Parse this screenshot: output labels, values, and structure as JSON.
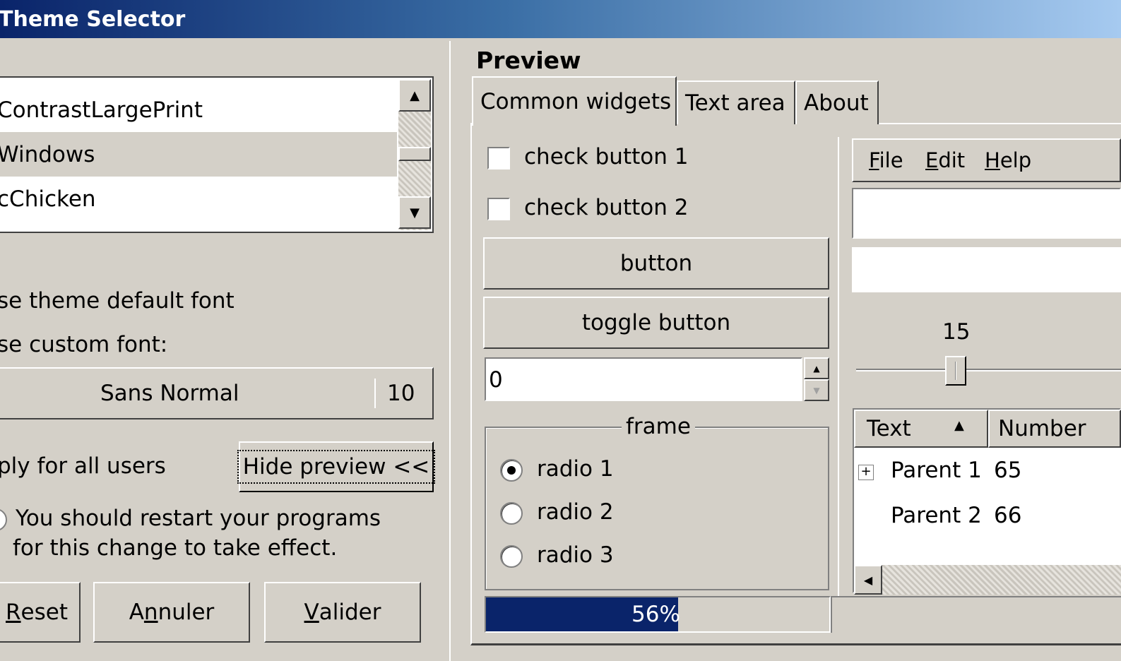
{
  "window": {
    "title": "Theme Selector"
  },
  "theme_list": {
    "items": [
      {
        "label": "ContrastLargePrint",
        "selected": false
      },
      {
        "label": "Windows",
        "selected": true
      },
      {
        "label": "cChicken",
        "selected": false
      }
    ]
  },
  "font": {
    "default_option": "se theme default font",
    "custom_option": "se custom font:",
    "name": "Sans Normal",
    "size": "10"
  },
  "apply_all_users": "ply for all users",
  "hide_preview_button": "Hide preview <<",
  "restart_note": {
    "line1": "You should restart your programs",
    "line2": "for this change to take effect."
  },
  "buttons": {
    "reset": {
      "pre": "",
      "mnemonic": "R",
      "post": "eset"
    },
    "cancel": {
      "pre": "A",
      "mnemonic": "n",
      "post": "nuler"
    },
    "ok": {
      "pre": "",
      "mnemonic": "V",
      "post": "alider"
    }
  },
  "preview": {
    "title": "Preview",
    "tabs": [
      {
        "label": "Common widgets",
        "active": true
      },
      {
        "label": "Text area",
        "active": false
      },
      {
        "label": "About",
        "active": false
      }
    ],
    "check_button_1": "check button 1",
    "check_button_2": "check button 2",
    "button": "button",
    "toggle_button": "toggle button",
    "spin_value": "0",
    "frame_label": "frame",
    "radios": [
      "radio 1",
      "radio 2",
      "radio 3"
    ],
    "radio_selected": 0,
    "progress": {
      "value": 0.56,
      "label": "56%"
    },
    "menu": {
      "file": {
        "mnemonic": "F",
        "rest": "ile"
      },
      "edit": {
        "mnemonic": "E",
        "rest": "dit"
      },
      "help": {
        "mnemonic": "H",
        "rest": "elp"
      }
    },
    "scale_value": "15",
    "tree": {
      "columns": [
        "Text",
        "Number"
      ],
      "rows": [
        {
          "text": "Parent 1",
          "number": "65"
        },
        {
          "text": "Parent 2",
          "number": "66"
        }
      ]
    }
  },
  "colors": {
    "face": "#d4d0c8",
    "title_start": "#0a246a",
    "title_end": "#a6caf0",
    "selection": "#d4d0c8",
    "progress": "#0a246a"
  },
  "icons": {
    "scroll_up": "arrow-up-icon",
    "scroll_down": "arrow-down-icon",
    "expand": "expand-plus-icon",
    "sort": "sort-ascending-icon"
  }
}
